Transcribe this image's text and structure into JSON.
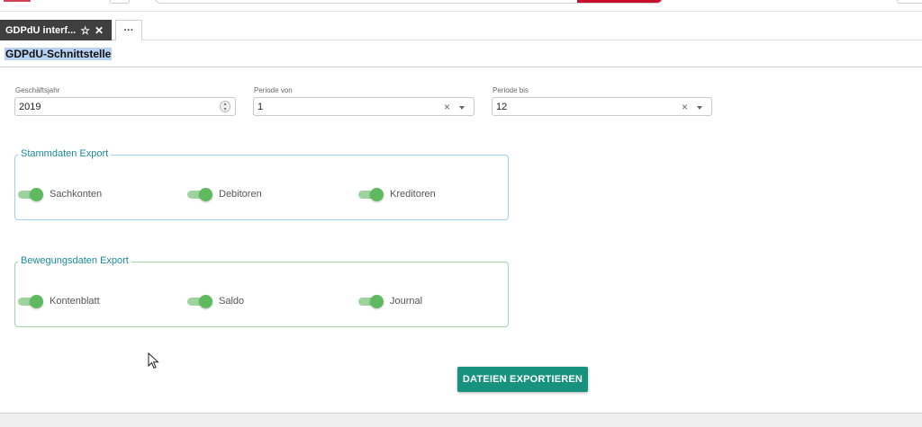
{
  "tabs": {
    "active_label": "GDPdU interf...",
    "more_label": "···"
  },
  "page": {
    "title": "GDPdU-Schnittstelle"
  },
  "fields": {
    "year_label": "Geschäftsjahr",
    "year_value": "2019",
    "period_from_label": "Periode von",
    "period_from_value": "1",
    "period_to_label": "Periode bis",
    "period_to_value": "12"
  },
  "stammdaten": {
    "legend": "Stammdaten Export",
    "toggles": [
      {
        "label": "Sachkonten",
        "checked": true
      },
      {
        "label": "Debitoren",
        "checked": true
      },
      {
        "label": "Kreditoren",
        "checked": true
      }
    ]
  },
  "bewegungsdaten": {
    "legend": "Bewegungsdaten Export",
    "toggles": [
      {
        "label": "Kontenblatt",
        "checked": true
      },
      {
        "label": "Saldo",
        "checked": true
      },
      {
        "label": "Journal",
        "checked": true
      }
    ]
  },
  "actions": {
    "export_label": "DATEIEN EXPORTIEREN"
  },
  "colors": {
    "accent": "#16927f",
    "toggle_on": "#5fb95f",
    "legend_text": "#1e8a99",
    "brand_red": "#c8102e"
  }
}
